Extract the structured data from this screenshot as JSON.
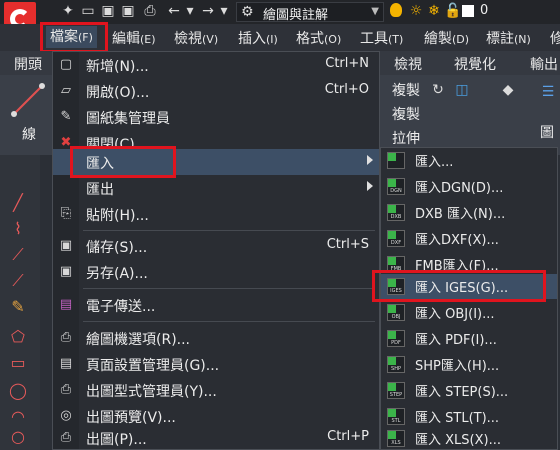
{
  "app": {
    "workspace": "繪圖與註解",
    "layer_number": "0"
  },
  "menubar": [
    {
      "label": "檔案",
      "acc": "(F)",
      "active": true
    },
    {
      "label": "編輯",
      "acc": "(E)"
    },
    {
      "label": "檢視",
      "acc": "(V)"
    },
    {
      "label": "插入",
      "acc": "(I)"
    },
    {
      "label": "格式",
      "acc": "(O)"
    },
    {
      "label": "工具",
      "acc": "(T)"
    },
    {
      "label": "繪製",
      "acc": "(D)"
    },
    {
      "label": "標註",
      "acc": "(N)"
    },
    {
      "label": "修",
      "acc": ""
    }
  ],
  "ribbon": {
    "tabs": [
      "開頭",
      "檢視",
      "視覺化",
      "輸出"
    ],
    "draw_label": "線",
    "copy_label": "複製",
    "copy_label2": "複製",
    "stretch_label": "拉伸",
    "image_label": "圖"
  },
  "file_menu": [
    {
      "icon": "new-icon",
      "glyph": "▢",
      "label": "新增(N)...",
      "shortcut": "Ctrl+N"
    },
    {
      "icon": "open-icon",
      "glyph": "📂",
      "label": "開啟(O)...",
      "shortcut": "Ctrl+O"
    },
    {
      "icon": "sheet-set-icon",
      "glyph": "🗀",
      "label": "圖紙集管理員",
      "shortcut": ""
    },
    {
      "icon": "close-icon",
      "glyph": "✖",
      "label": "關閉(C)",
      "shortcut": ""
    },
    {
      "icon": "",
      "glyph": "",
      "label": "匯入",
      "shortcut": "",
      "submenu": true,
      "highlight": true
    },
    {
      "icon": "",
      "glyph": "",
      "label": "匯出",
      "shortcut": "",
      "submenu": true
    },
    {
      "icon": "paste-icon",
      "glyph": "⎘",
      "label": "貼附(H)...",
      "shortcut": ""
    },
    {
      "icon": "save-icon",
      "glyph": "💾",
      "label": "儲存(S)...",
      "shortcut": "Ctrl+S"
    },
    {
      "icon": "save-as-icon",
      "glyph": "💾",
      "label": "另存(A)...",
      "shortcut": ""
    },
    {
      "icon": "etransmit-icon",
      "glyph": "✉",
      "label": "電子傳送...",
      "shortcut": ""
    },
    {
      "icon": "plotter-icon",
      "glyph": "🖶",
      "label": "繪圖機選項(R)...",
      "shortcut": ""
    },
    {
      "icon": "page-setup-icon",
      "glyph": "🗎",
      "label": "頁面設置管理員(G)...",
      "shortcut": ""
    },
    {
      "icon": "plot-style-icon",
      "glyph": "🖶",
      "label": "出圖型式管理員(Y)...",
      "shortcut": ""
    },
    {
      "icon": "plot-preview-icon",
      "glyph": "🔍",
      "label": "出圖預覽(V)...",
      "shortcut": ""
    },
    {
      "icon": "plot-icon",
      "glyph": "🖶",
      "label": "出圖(P)...",
      "shortcut": "Ctrl+P"
    }
  ],
  "import_submenu": [
    {
      "icon": "import-icon",
      "tag": "",
      "label": "匯入..."
    },
    {
      "icon": "dgn-icon",
      "tag": "DGN",
      "label": "匯入DGN(D)..."
    },
    {
      "icon": "dxb-icon",
      "tag": "DXB",
      "label": "DXB 匯入(N)..."
    },
    {
      "icon": "dxf-icon",
      "tag": "DXF",
      "label": "匯入DXF(X)..."
    },
    {
      "icon": "fmb-icon",
      "tag": "FMB",
      "label": "FMB匯入(F)..."
    },
    {
      "icon": "iges-icon",
      "tag": "IGES",
      "label": "匯入 IGES(G)...",
      "highlight": true
    },
    {
      "icon": "obj-icon",
      "tag": "OBJ",
      "label": "匯入 OBJ(I)..."
    },
    {
      "icon": "pdf-icon",
      "tag": "PDF",
      "label": "匯入 PDF(I)..."
    },
    {
      "icon": "shp-icon",
      "tag": "SHP",
      "label": "SHP匯入(H)..."
    },
    {
      "icon": "step-icon",
      "tag": "STEP",
      "label": "匯入 STEP(S)..."
    },
    {
      "icon": "stl-icon",
      "tag": "STL",
      "label": "匯入 STL(T)..."
    },
    {
      "icon": "xls-icon",
      "tag": "XLS",
      "label": "匯入 XLS(X)..."
    }
  ]
}
